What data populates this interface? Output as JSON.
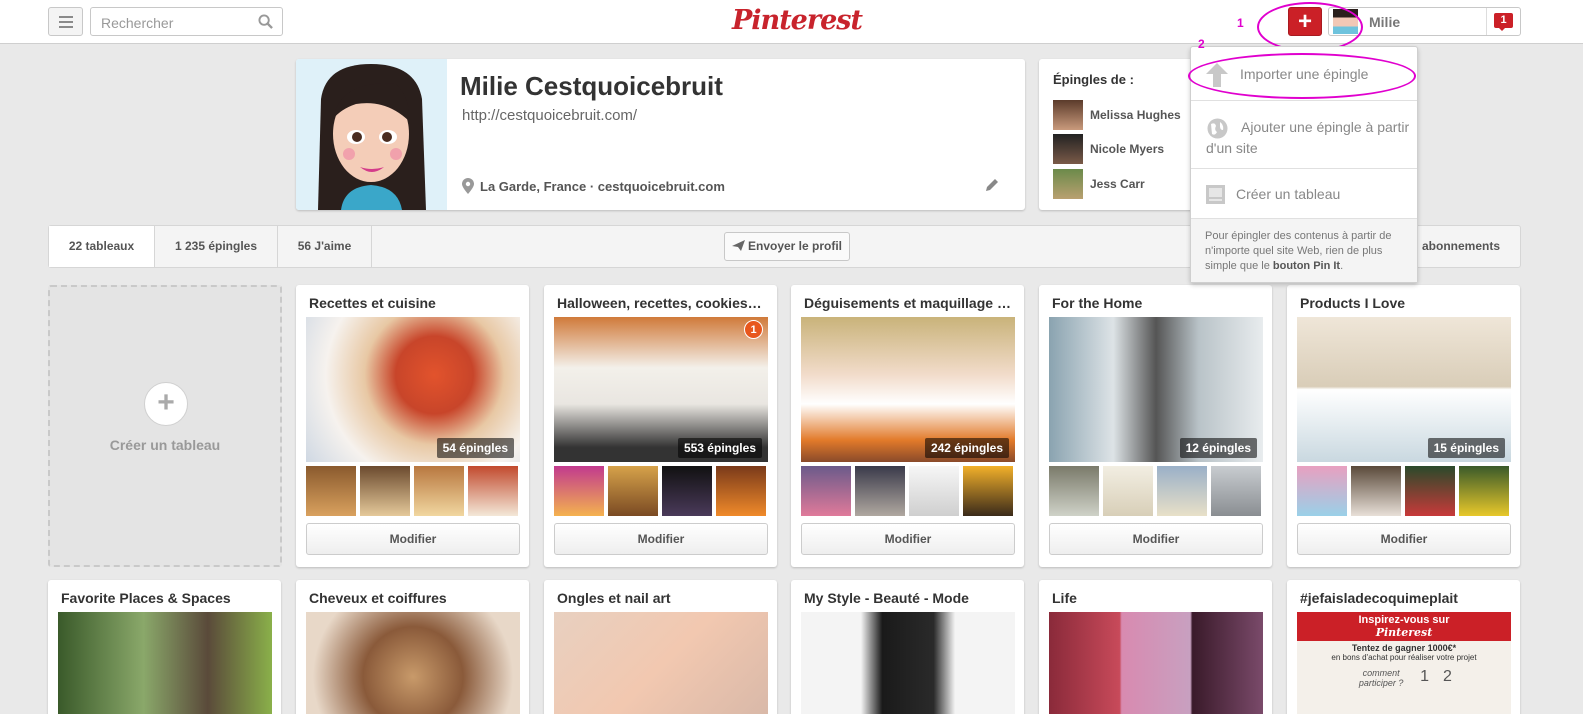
{
  "header": {
    "search_placeholder": "Rechercher",
    "logo": "Pinterest",
    "add_symbol": "+",
    "user_name": "Milie",
    "notification_count": "1"
  },
  "annotations": {
    "step1": "1",
    "step2": "2",
    "ring_color": "#e000ce"
  },
  "profile": {
    "name": "Milie Cestquoicebruit",
    "url": "http://cestquoicebruit.com/",
    "location": "La Garde, France · cestquoicebruit.com"
  },
  "pins_from": {
    "title": "Épingles de :",
    "users": [
      {
        "name": "Melissa Hughes"
      },
      {
        "name": "Nicole Myers"
      },
      {
        "name": "Jess Carr"
      }
    ]
  },
  "stats": {
    "boards": "22 tableaux",
    "pins_num": "1",
    "pins_rest": " 235 épingles",
    "likes": "56 J'aime",
    "send_profile": "Envoyer le profil",
    "following": "abonnements"
  },
  "dropdown": {
    "import_pin": "Importer une épingle",
    "add_from_site": "Ajouter une épingle à partir d'un site",
    "create_board": "Créer un tableau",
    "help_text": "Pour épingler des contenus à partir de n'importe quel site Web, rien de plus simple que le ",
    "help_link": "bouton Pin It",
    "help_end": "."
  },
  "create_board_card": {
    "label": "Créer un tableau",
    "plus": "+"
  },
  "boards": [
    {
      "title": "Recettes et cuisine",
      "pins": "54 épingles",
      "button": "Modifier"
    },
    {
      "title": "Halloween, recettes, cookies, déco...",
      "pins": "553 épingles",
      "button": "Modifier",
      "badge": "1"
    },
    {
      "title": "Déguisements et maquillage Halloween",
      "pins": "242 épingles",
      "button": "Modifier"
    },
    {
      "title": "For the Home",
      "pins": "12 épingles",
      "button": "Modifier"
    },
    {
      "title": "Products I Love",
      "pins": "15 épingles",
      "button": "Modifier"
    }
  ],
  "boards_row2": [
    {
      "title": "Favorite Places & Spaces"
    },
    {
      "title": "Cheveux et coiffures"
    },
    {
      "title": "Ongles et nail art"
    },
    {
      "title": "My Style - Beauté - Mode"
    },
    {
      "title": "Life"
    },
    {
      "title": "#jefaisladecoquimeplait"
    }
  ],
  "inspire_card": {
    "line1": "Inspirez-vous sur",
    "logo": "Pinterest",
    "line2": "Tentez de gagner 1000€*",
    "line3": "en bons d'achat pour réaliser votre projet",
    "question": "comment participer ?",
    "n1": "1",
    "n2": "2"
  }
}
